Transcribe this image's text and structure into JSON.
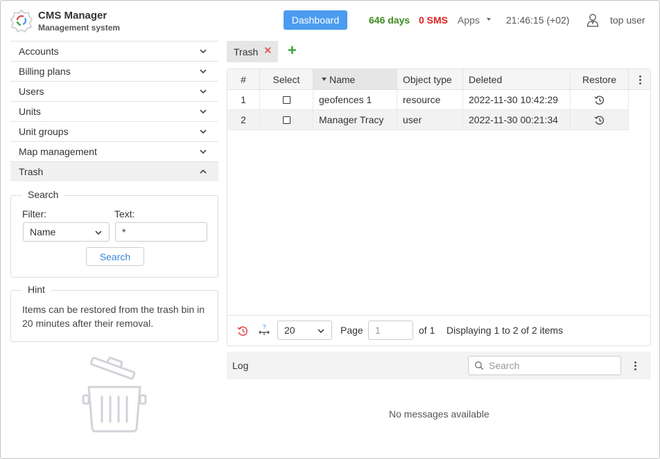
{
  "header": {
    "app_title": "CMS Manager",
    "app_subtitle": "Management system",
    "dashboard_label": "Dashboard",
    "days": "646 days",
    "sms": "0 SMS",
    "apps_label": "Apps",
    "clock": "21:46:15 (+02)",
    "user_name": "top user",
    "colors": {
      "accent": "#4b9cf0",
      "days": "#3d8b1f",
      "sms": "#e02020"
    }
  },
  "sidebar": {
    "items": [
      {
        "label": "Accounts",
        "expanded": false
      },
      {
        "label": "Billing plans",
        "expanded": false
      },
      {
        "label": "Users",
        "expanded": false
      },
      {
        "label": "Units",
        "expanded": false
      },
      {
        "label": "Unit groups",
        "expanded": false
      },
      {
        "label": "Map management",
        "expanded": false
      },
      {
        "label": "Trash",
        "expanded": true
      }
    ],
    "search": {
      "legend": "Search",
      "filter_label": "Filter:",
      "filter_value": "Name",
      "text_label": "Text:",
      "text_value": "*",
      "button_label": "Search"
    },
    "hint": {
      "legend": "Hint",
      "text": "Items can be restored from the trash bin in 20 minutes after their removal."
    }
  },
  "tabs": [
    {
      "label": "Trash",
      "closable": true
    }
  ],
  "table": {
    "columns": [
      "#",
      "Select",
      "Name",
      "Object type",
      "Deleted",
      "Restore"
    ],
    "sorted_column": "Name",
    "rows": [
      {
        "num": "1",
        "name": "geofences 1",
        "type": "resource",
        "deleted": "2022-11-30 10:42:29"
      },
      {
        "num": "2",
        "name": "Manager Tracy",
        "type": "user",
        "deleted": "2022-11-30 00:21:34"
      }
    ]
  },
  "pager": {
    "page_size": "20",
    "page_label": "Page",
    "page_value": "1",
    "of_label": "of 1",
    "display_text": "Displaying 1 to 2 of 2 items"
  },
  "log": {
    "title": "Log",
    "search_placeholder": "Search",
    "empty_text": "No messages available"
  }
}
